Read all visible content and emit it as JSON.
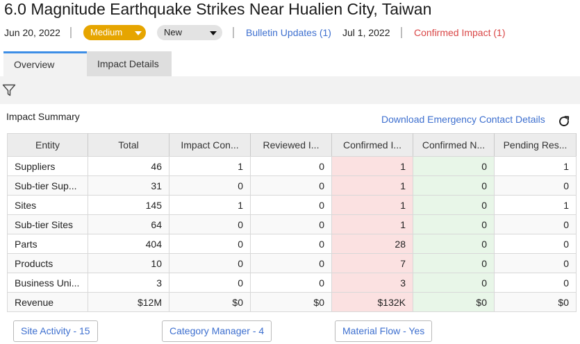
{
  "header": {
    "title": "6.0 Magnitude Earthquake Strikes Near Hualien City, Taiwan"
  },
  "meta": {
    "date": "Jun 20, 2022",
    "severity": "Medium",
    "status": "New",
    "bulletin_updates": "Bulletin Updates (1)",
    "update_date": "Jul 1, 2022",
    "confirmed_impact": "Confirmed Impact (1)",
    "colors": {
      "severity": "#e6a500",
      "link": "#3d6fcf",
      "alert": "#d94545"
    }
  },
  "tabs": [
    {
      "label": "Overview",
      "active": true
    },
    {
      "label": "Impact Details",
      "active": false
    }
  ],
  "toolbar": {
    "filter_icon": "filter-icon"
  },
  "impact_summary": {
    "title": "Impact Summary",
    "download_link": "Download Emergency Contact Details",
    "refresh_icon": "refresh-icon",
    "columns": [
      "Entity",
      "Total",
      "Impact Con...",
      "Reviewed I...",
      "Confirmed I...",
      "Confirmed N...",
      "Pending Res..."
    ],
    "rows": [
      {
        "entity": "Suppliers",
        "total": "46",
        "impact_con": "1",
        "reviewed": "0",
        "confirmed_impact": "1",
        "confirmed_n": "0",
        "pending": "1"
      },
      {
        "entity": "Sub-tier Sup...",
        "total": "31",
        "impact_con": "0",
        "reviewed": "0",
        "confirmed_impact": "1",
        "confirmed_n": "0",
        "pending": "0"
      },
      {
        "entity": "Sites",
        "total": "145",
        "impact_con": "1",
        "reviewed": "0",
        "confirmed_impact": "1",
        "confirmed_n": "0",
        "pending": "1"
      },
      {
        "entity": "Sub-tier Sites",
        "total": "64",
        "impact_con": "0",
        "reviewed": "0",
        "confirmed_impact": "1",
        "confirmed_n": "0",
        "pending": "0"
      },
      {
        "entity": "Parts",
        "total": "404",
        "impact_con": "0",
        "reviewed": "0",
        "confirmed_impact": "28",
        "confirmed_n": "0",
        "pending": "0"
      },
      {
        "entity": "Products",
        "total": "10",
        "impact_con": "0",
        "reviewed": "0",
        "confirmed_impact": "7",
        "confirmed_n": "0",
        "pending": "0"
      },
      {
        "entity": "Business Uni...",
        "total": "3",
        "impact_con": "0",
        "reviewed": "0",
        "confirmed_impact": "3",
        "confirmed_n": "0",
        "pending": "0"
      },
      {
        "entity": "Revenue",
        "total": "$12M",
        "impact_con": "$0",
        "reviewed": "$0",
        "confirmed_impact": "$132K",
        "confirmed_n": "$0",
        "pending": "$0"
      }
    ]
  },
  "footer_buttons": [
    {
      "label": "Site Activity - 15"
    },
    {
      "label": "Category Manager - 4"
    },
    {
      "label": "Material Flow - Yes"
    }
  ]
}
